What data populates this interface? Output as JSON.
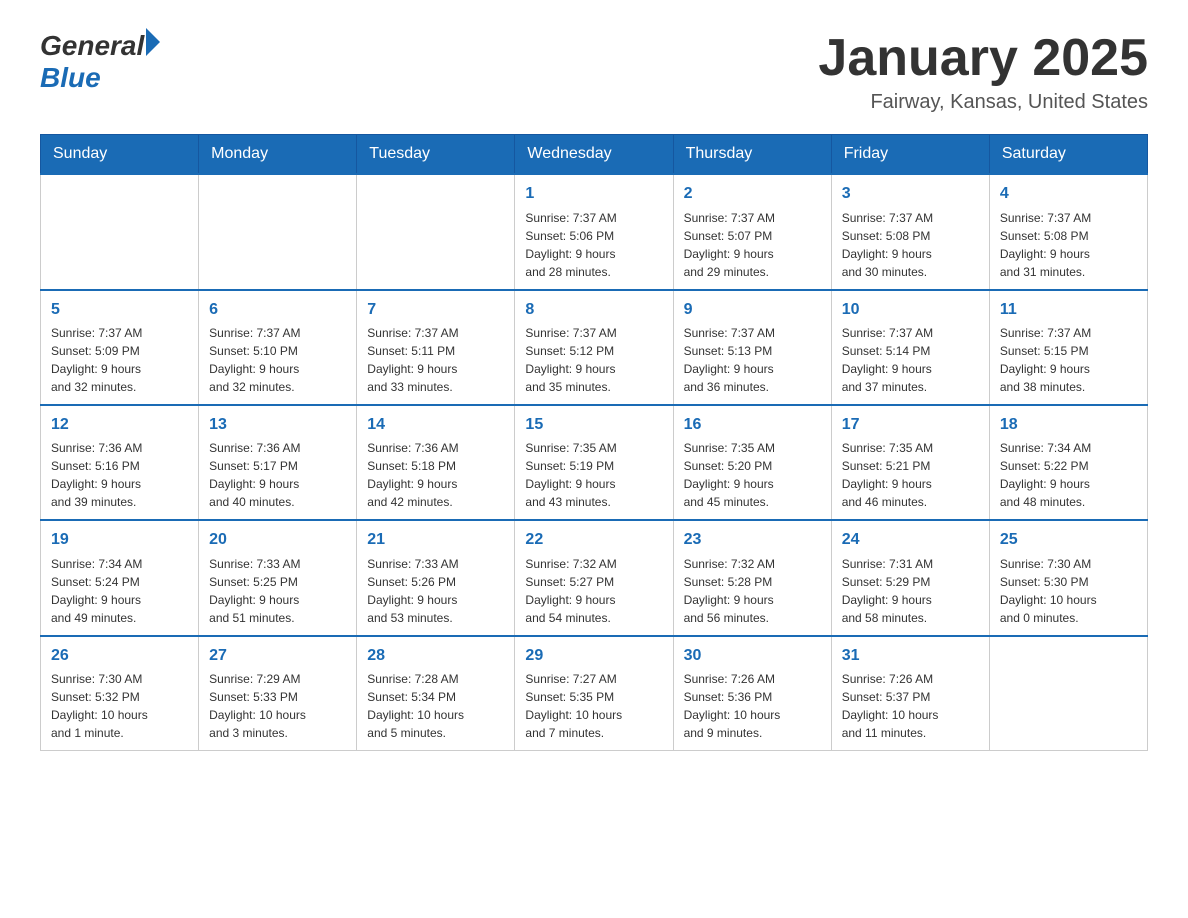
{
  "header": {
    "logo_general": "General",
    "logo_blue": "Blue",
    "month_title": "January 2025",
    "location": "Fairway, Kansas, United States"
  },
  "days_of_week": [
    "Sunday",
    "Monday",
    "Tuesday",
    "Wednesday",
    "Thursday",
    "Friday",
    "Saturday"
  ],
  "weeks": [
    [
      {
        "day": "",
        "info": ""
      },
      {
        "day": "",
        "info": ""
      },
      {
        "day": "",
        "info": ""
      },
      {
        "day": "1",
        "info": "Sunrise: 7:37 AM\nSunset: 5:06 PM\nDaylight: 9 hours\nand 28 minutes."
      },
      {
        "day": "2",
        "info": "Sunrise: 7:37 AM\nSunset: 5:07 PM\nDaylight: 9 hours\nand 29 minutes."
      },
      {
        "day": "3",
        "info": "Sunrise: 7:37 AM\nSunset: 5:08 PM\nDaylight: 9 hours\nand 30 minutes."
      },
      {
        "day": "4",
        "info": "Sunrise: 7:37 AM\nSunset: 5:08 PM\nDaylight: 9 hours\nand 31 minutes."
      }
    ],
    [
      {
        "day": "5",
        "info": "Sunrise: 7:37 AM\nSunset: 5:09 PM\nDaylight: 9 hours\nand 32 minutes."
      },
      {
        "day": "6",
        "info": "Sunrise: 7:37 AM\nSunset: 5:10 PM\nDaylight: 9 hours\nand 32 minutes."
      },
      {
        "day": "7",
        "info": "Sunrise: 7:37 AM\nSunset: 5:11 PM\nDaylight: 9 hours\nand 33 minutes."
      },
      {
        "day": "8",
        "info": "Sunrise: 7:37 AM\nSunset: 5:12 PM\nDaylight: 9 hours\nand 35 minutes."
      },
      {
        "day": "9",
        "info": "Sunrise: 7:37 AM\nSunset: 5:13 PM\nDaylight: 9 hours\nand 36 minutes."
      },
      {
        "day": "10",
        "info": "Sunrise: 7:37 AM\nSunset: 5:14 PM\nDaylight: 9 hours\nand 37 minutes."
      },
      {
        "day": "11",
        "info": "Sunrise: 7:37 AM\nSunset: 5:15 PM\nDaylight: 9 hours\nand 38 minutes."
      }
    ],
    [
      {
        "day": "12",
        "info": "Sunrise: 7:36 AM\nSunset: 5:16 PM\nDaylight: 9 hours\nand 39 minutes."
      },
      {
        "day": "13",
        "info": "Sunrise: 7:36 AM\nSunset: 5:17 PM\nDaylight: 9 hours\nand 40 minutes."
      },
      {
        "day": "14",
        "info": "Sunrise: 7:36 AM\nSunset: 5:18 PM\nDaylight: 9 hours\nand 42 minutes."
      },
      {
        "day": "15",
        "info": "Sunrise: 7:35 AM\nSunset: 5:19 PM\nDaylight: 9 hours\nand 43 minutes."
      },
      {
        "day": "16",
        "info": "Sunrise: 7:35 AM\nSunset: 5:20 PM\nDaylight: 9 hours\nand 45 minutes."
      },
      {
        "day": "17",
        "info": "Sunrise: 7:35 AM\nSunset: 5:21 PM\nDaylight: 9 hours\nand 46 minutes."
      },
      {
        "day": "18",
        "info": "Sunrise: 7:34 AM\nSunset: 5:22 PM\nDaylight: 9 hours\nand 48 minutes."
      }
    ],
    [
      {
        "day": "19",
        "info": "Sunrise: 7:34 AM\nSunset: 5:24 PM\nDaylight: 9 hours\nand 49 minutes."
      },
      {
        "day": "20",
        "info": "Sunrise: 7:33 AM\nSunset: 5:25 PM\nDaylight: 9 hours\nand 51 minutes."
      },
      {
        "day": "21",
        "info": "Sunrise: 7:33 AM\nSunset: 5:26 PM\nDaylight: 9 hours\nand 53 minutes."
      },
      {
        "day": "22",
        "info": "Sunrise: 7:32 AM\nSunset: 5:27 PM\nDaylight: 9 hours\nand 54 minutes."
      },
      {
        "day": "23",
        "info": "Sunrise: 7:32 AM\nSunset: 5:28 PM\nDaylight: 9 hours\nand 56 minutes."
      },
      {
        "day": "24",
        "info": "Sunrise: 7:31 AM\nSunset: 5:29 PM\nDaylight: 9 hours\nand 58 minutes."
      },
      {
        "day": "25",
        "info": "Sunrise: 7:30 AM\nSunset: 5:30 PM\nDaylight: 10 hours\nand 0 minutes."
      }
    ],
    [
      {
        "day": "26",
        "info": "Sunrise: 7:30 AM\nSunset: 5:32 PM\nDaylight: 10 hours\nand 1 minute."
      },
      {
        "day": "27",
        "info": "Sunrise: 7:29 AM\nSunset: 5:33 PM\nDaylight: 10 hours\nand 3 minutes."
      },
      {
        "day": "28",
        "info": "Sunrise: 7:28 AM\nSunset: 5:34 PM\nDaylight: 10 hours\nand 5 minutes."
      },
      {
        "day": "29",
        "info": "Sunrise: 7:27 AM\nSunset: 5:35 PM\nDaylight: 10 hours\nand 7 minutes."
      },
      {
        "day": "30",
        "info": "Sunrise: 7:26 AM\nSunset: 5:36 PM\nDaylight: 10 hours\nand 9 minutes."
      },
      {
        "day": "31",
        "info": "Sunrise: 7:26 AM\nSunset: 5:37 PM\nDaylight: 10 hours\nand 11 minutes."
      },
      {
        "day": "",
        "info": ""
      }
    ]
  ]
}
